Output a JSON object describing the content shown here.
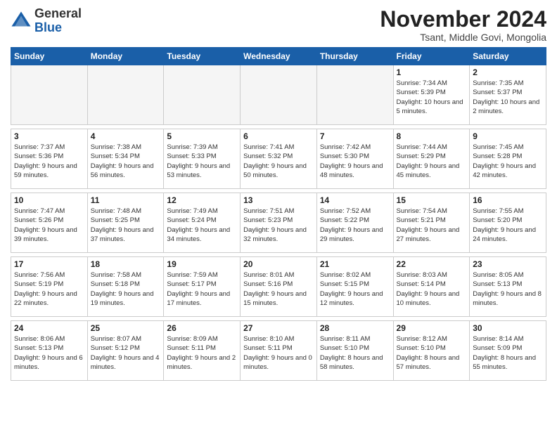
{
  "logo": {
    "general": "General",
    "blue": "Blue"
  },
  "header": {
    "month": "November 2024",
    "location": "Tsant, Middle Govi, Mongolia"
  },
  "days_of_week": [
    "Sunday",
    "Monday",
    "Tuesday",
    "Wednesday",
    "Thursday",
    "Friday",
    "Saturday"
  ],
  "weeks": [
    {
      "days": [
        {
          "num": "",
          "empty": true
        },
        {
          "num": "",
          "empty": true
        },
        {
          "num": "",
          "empty": true
        },
        {
          "num": "",
          "empty": true
        },
        {
          "num": "",
          "empty": true
        },
        {
          "num": "1",
          "sunrise": "Sunrise: 7:34 AM",
          "sunset": "Sunset: 5:39 PM",
          "daylight": "Daylight: 10 hours and 5 minutes."
        },
        {
          "num": "2",
          "sunrise": "Sunrise: 7:35 AM",
          "sunset": "Sunset: 5:37 PM",
          "daylight": "Daylight: 10 hours and 2 minutes."
        }
      ]
    },
    {
      "days": [
        {
          "num": "3",
          "sunrise": "Sunrise: 7:37 AM",
          "sunset": "Sunset: 5:36 PM",
          "daylight": "Daylight: 9 hours and 59 minutes."
        },
        {
          "num": "4",
          "sunrise": "Sunrise: 7:38 AM",
          "sunset": "Sunset: 5:34 PM",
          "daylight": "Daylight: 9 hours and 56 minutes."
        },
        {
          "num": "5",
          "sunrise": "Sunrise: 7:39 AM",
          "sunset": "Sunset: 5:33 PM",
          "daylight": "Daylight: 9 hours and 53 minutes."
        },
        {
          "num": "6",
          "sunrise": "Sunrise: 7:41 AM",
          "sunset": "Sunset: 5:32 PM",
          "daylight": "Daylight: 9 hours and 50 minutes."
        },
        {
          "num": "7",
          "sunrise": "Sunrise: 7:42 AM",
          "sunset": "Sunset: 5:30 PM",
          "daylight": "Daylight: 9 hours and 48 minutes."
        },
        {
          "num": "8",
          "sunrise": "Sunrise: 7:44 AM",
          "sunset": "Sunset: 5:29 PM",
          "daylight": "Daylight: 9 hours and 45 minutes."
        },
        {
          "num": "9",
          "sunrise": "Sunrise: 7:45 AM",
          "sunset": "Sunset: 5:28 PM",
          "daylight": "Daylight: 9 hours and 42 minutes."
        }
      ]
    },
    {
      "days": [
        {
          "num": "10",
          "sunrise": "Sunrise: 7:47 AM",
          "sunset": "Sunset: 5:26 PM",
          "daylight": "Daylight: 9 hours and 39 minutes."
        },
        {
          "num": "11",
          "sunrise": "Sunrise: 7:48 AM",
          "sunset": "Sunset: 5:25 PM",
          "daylight": "Daylight: 9 hours and 37 minutes."
        },
        {
          "num": "12",
          "sunrise": "Sunrise: 7:49 AM",
          "sunset": "Sunset: 5:24 PM",
          "daylight": "Daylight: 9 hours and 34 minutes."
        },
        {
          "num": "13",
          "sunrise": "Sunrise: 7:51 AM",
          "sunset": "Sunset: 5:23 PM",
          "daylight": "Daylight: 9 hours and 32 minutes."
        },
        {
          "num": "14",
          "sunrise": "Sunrise: 7:52 AM",
          "sunset": "Sunset: 5:22 PM",
          "daylight": "Daylight: 9 hours and 29 minutes."
        },
        {
          "num": "15",
          "sunrise": "Sunrise: 7:54 AM",
          "sunset": "Sunset: 5:21 PM",
          "daylight": "Daylight: 9 hours and 27 minutes."
        },
        {
          "num": "16",
          "sunrise": "Sunrise: 7:55 AM",
          "sunset": "Sunset: 5:20 PM",
          "daylight": "Daylight: 9 hours and 24 minutes."
        }
      ]
    },
    {
      "days": [
        {
          "num": "17",
          "sunrise": "Sunrise: 7:56 AM",
          "sunset": "Sunset: 5:19 PM",
          "daylight": "Daylight: 9 hours and 22 minutes."
        },
        {
          "num": "18",
          "sunrise": "Sunrise: 7:58 AM",
          "sunset": "Sunset: 5:18 PM",
          "daylight": "Daylight: 9 hours and 19 minutes."
        },
        {
          "num": "19",
          "sunrise": "Sunrise: 7:59 AM",
          "sunset": "Sunset: 5:17 PM",
          "daylight": "Daylight: 9 hours and 17 minutes."
        },
        {
          "num": "20",
          "sunrise": "Sunrise: 8:01 AM",
          "sunset": "Sunset: 5:16 PM",
          "daylight": "Daylight: 9 hours and 15 minutes."
        },
        {
          "num": "21",
          "sunrise": "Sunrise: 8:02 AM",
          "sunset": "Sunset: 5:15 PM",
          "daylight": "Daylight: 9 hours and 12 minutes."
        },
        {
          "num": "22",
          "sunrise": "Sunrise: 8:03 AM",
          "sunset": "Sunset: 5:14 PM",
          "daylight": "Daylight: 9 hours and 10 minutes."
        },
        {
          "num": "23",
          "sunrise": "Sunrise: 8:05 AM",
          "sunset": "Sunset: 5:13 PM",
          "daylight": "Daylight: 9 hours and 8 minutes."
        }
      ]
    },
    {
      "days": [
        {
          "num": "24",
          "sunrise": "Sunrise: 8:06 AM",
          "sunset": "Sunset: 5:13 PM",
          "daylight": "Daylight: 9 hours and 6 minutes."
        },
        {
          "num": "25",
          "sunrise": "Sunrise: 8:07 AM",
          "sunset": "Sunset: 5:12 PM",
          "daylight": "Daylight: 9 hours and 4 minutes."
        },
        {
          "num": "26",
          "sunrise": "Sunrise: 8:09 AM",
          "sunset": "Sunset: 5:11 PM",
          "daylight": "Daylight: 9 hours and 2 minutes."
        },
        {
          "num": "27",
          "sunrise": "Sunrise: 8:10 AM",
          "sunset": "Sunset: 5:11 PM",
          "daylight": "Daylight: 9 hours and 0 minutes."
        },
        {
          "num": "28",
          "sunrise": "Sunrise: 8:11 AM",
          "sunset": "Sunset: 5:10 PM",
          "daylight": "Daylight: 8 hours and 58 minutes."
        },
        {
          "num": "29",
          "sunrise": "Sunrise: 8:12 AM",
          "sunset": "Sunset: 5:10 PM",
          "daylight": "Daylight: 8 hours and 57 minutes."
        },
        {
          "num": "30",
          "sunrise": "Sunrise: 8:14 AM",
          "sunset": "Sunset: 5:09 PM",
          "daylight": "Daylight: 8 hours and 55 minutes."
        }
      ]
    }
  ]
}
